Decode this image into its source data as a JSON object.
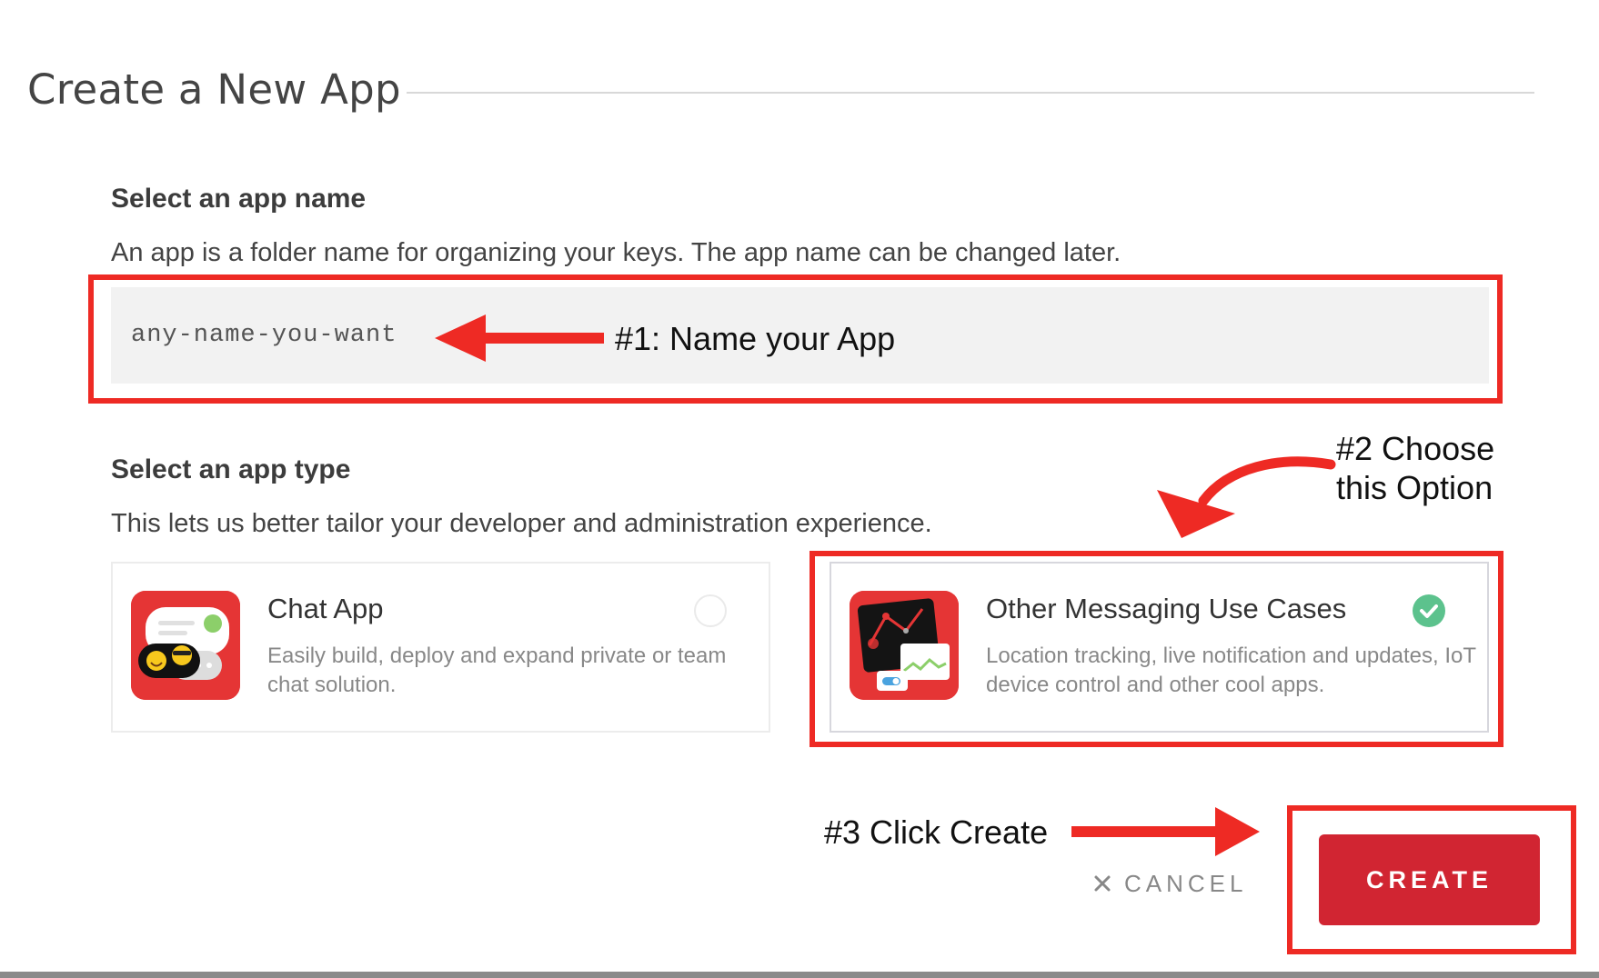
{
  "header": {
    "title": "Create a New App"
  },
  "name_section": {
    "heading": "Select an app name",
    "description": "An app is a folder name for organizing your keys. The app name can be changed later.",
    "input_value": "any-name-you-want"
  },
  "type_section": {
    "heading": "Select an app type",
    "description": "This lets us better tailor your developer and administration experience.",
    "options": [
      {
        "title": "Chat App",
        "description": "Easily build, deploy and expand private or team chat solution.",
        "icon": "chat-app-icon",
        "selected": false
      },
      {
        "title": "Other Messaging Use Cases",
        "description": "Location tracking, live notification and updates, IoT device control and other cool apps.",
        "icon": "messaging-app-icon",
        "selected": true
      }
    ]
  },
  "actions": {
    "cancel_label": "CANCEL",
    "create_label": "CREATE"
  },
  "annotations": {
    "step1": "#1: Name your App",
    "step2_line1": "#2 Choose",
    "step2_line2": "this Option",
    "step3": "#3 Click Create"
  },
  "colors": {
    "annotation_red": "#ee2a24",
    "create_button": "#d12532",
    "check_green": "#5cc28d",
    "icon_red": "#e53535"
  }
}
